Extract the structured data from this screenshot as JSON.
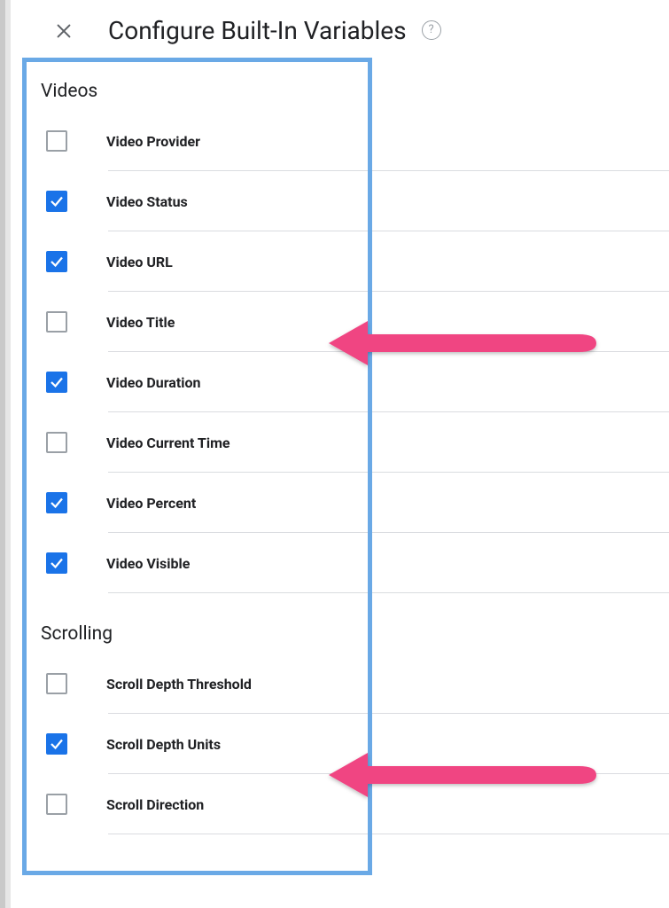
{
  "header": {
    "title": "Configure Built-In Variables"
  },
  "sections": [
    {
      "heading": "Videos",
      "items": [
        {
          "label": "Video Provider",
          "checked": false
        },
        {
          "label": "Video Status",
          "checked": true
        },
        {
          "label": "Video URL",
          "checked": true
        },
        {
          "label": "Video Title",
          "checked": false
        },
        {
          "label": "Video Duration",
          "checked": true
        },
        {
          "label": "Video Current Time",
          "checked": false
        },
        {
          "label": "Video Percent",
          "checked": true
        },
        {
          "label": "Video Visible",
          "checked": true
        }
      ]
    },
    {
      "heading": "Scrolling",
      "items": [
        {
          "label": "Scroll Depth Threshold",
          "checked": false
        },
        {
          "label": "Scroll Depth Units",
          "checked": true
        },
        {
          "label": "Scroll Direction",
          "checked": false
        }
      ]
    }
  ],
  "annotations": {
    "arrow_color": "#f04482",
    "highlight_color": "#6aa9e6"
  }
}
